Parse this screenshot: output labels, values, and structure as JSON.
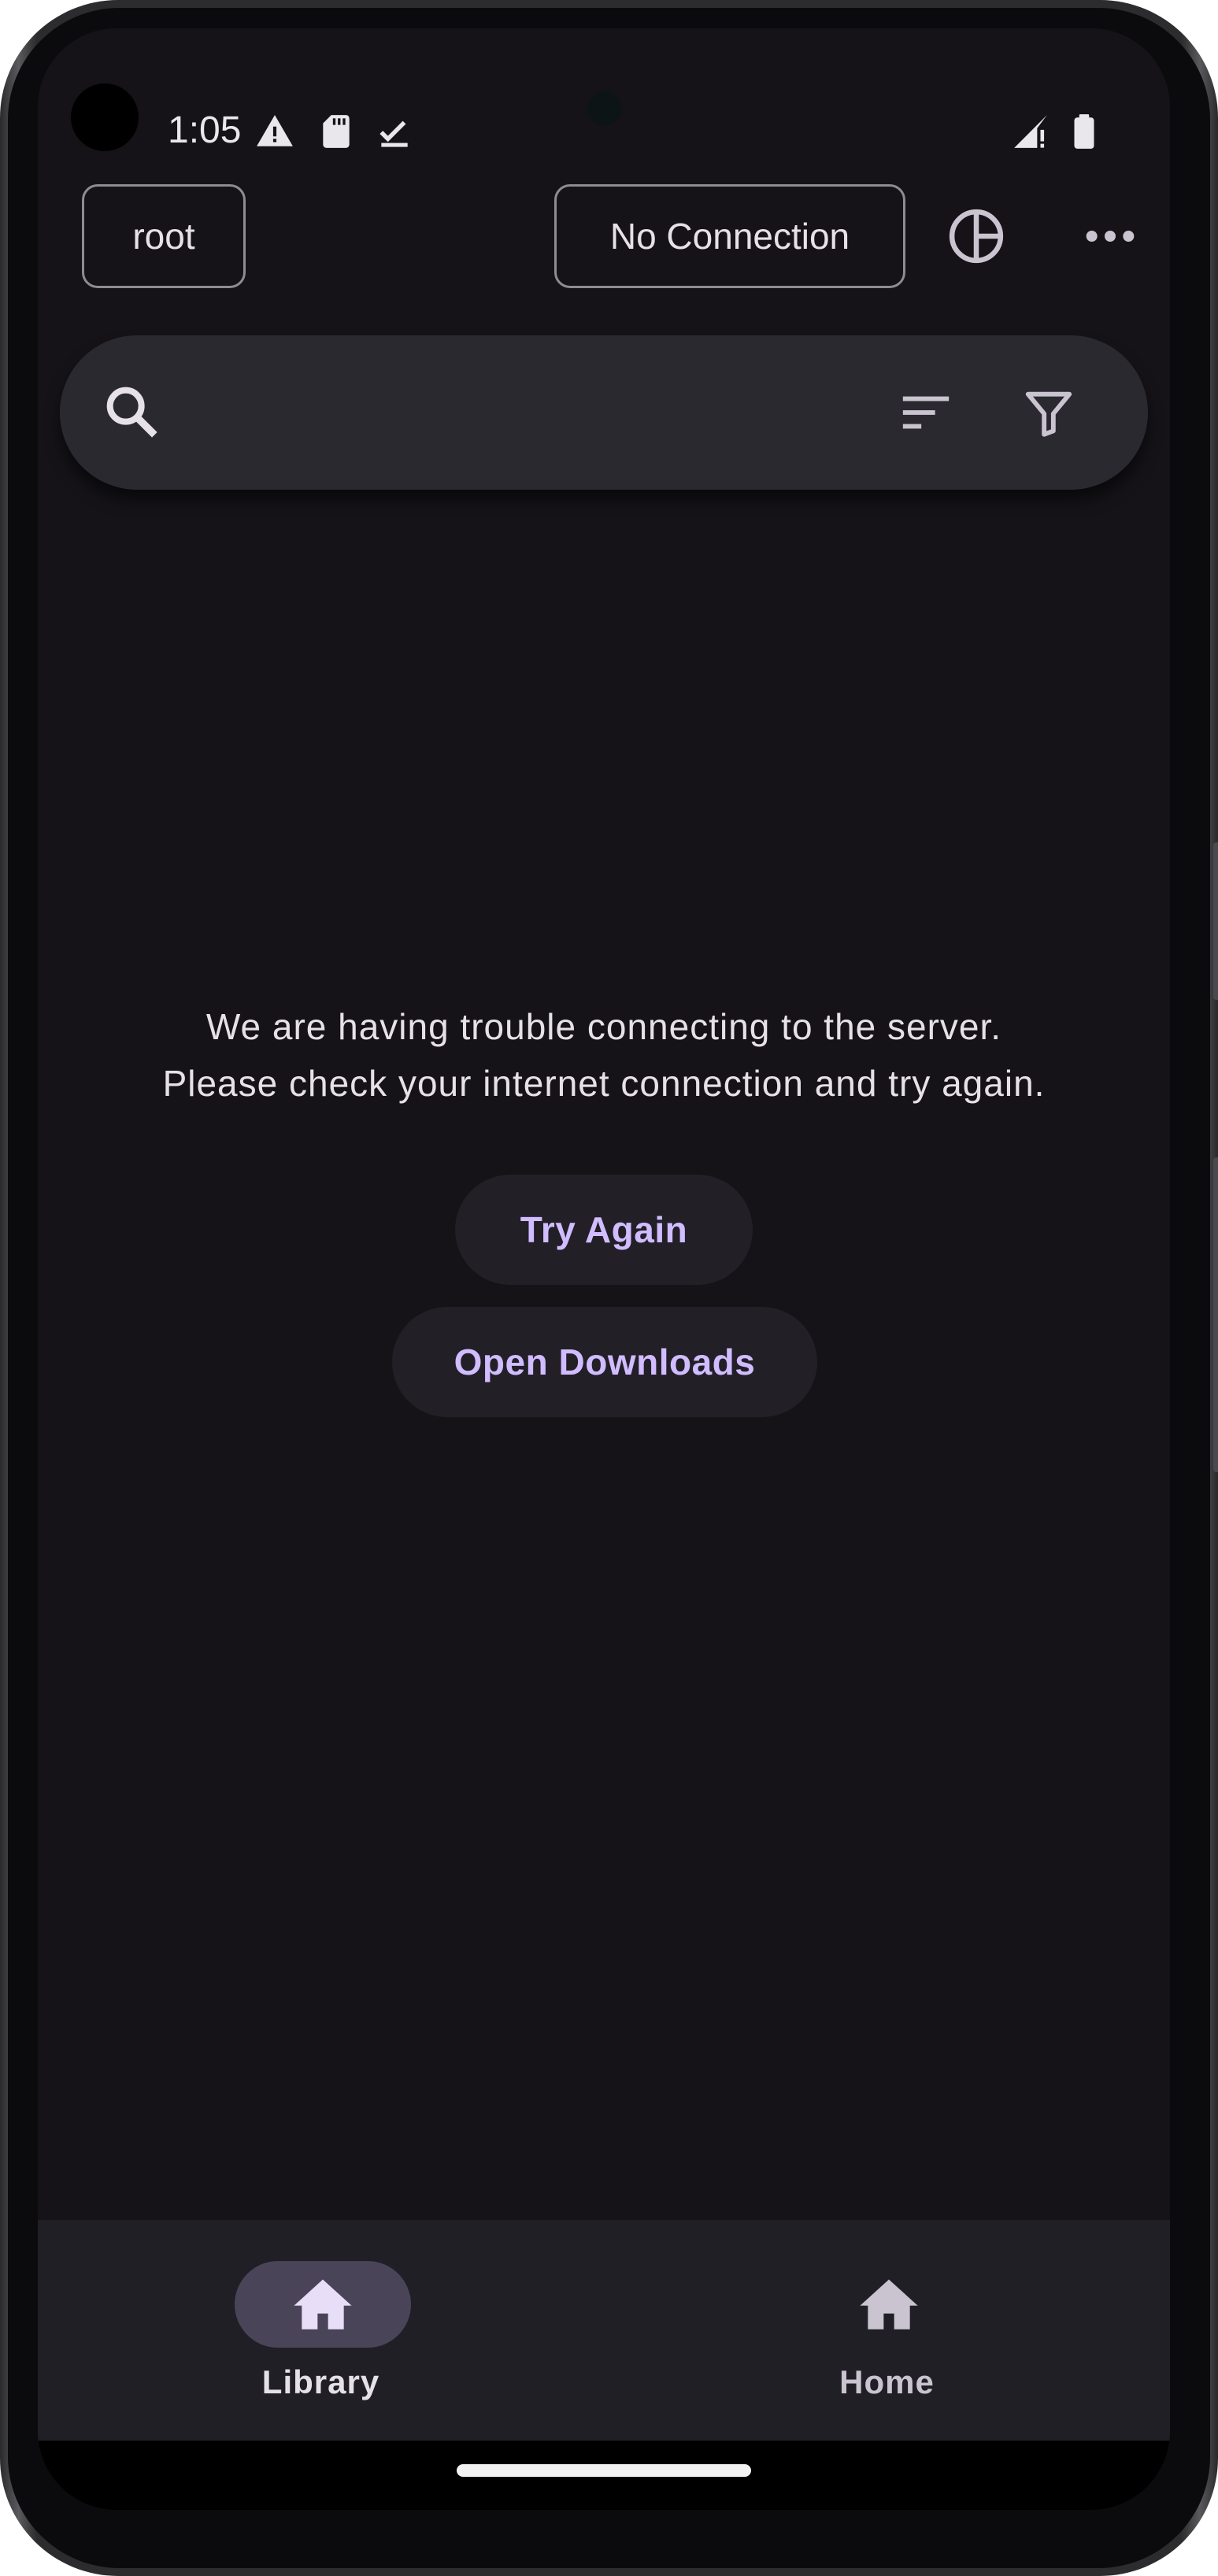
{
  "status_bar": {
    "time": "1:05",
    "left_icons": [
      "warning-icon",
      "sd-card-icon",
      "check-icon"
    ],
    "right_icons": [
      "signal-no-connection-icon",
      "battery-icon"
    ]
  },
  "app_bar": {
    "user_button": "root",
    "connection_button": "No Connection",
    "actions": [
      "pie-chart-icon",
      "more-options-icon"
    ]
  },
  "search": {
    "placeholder": "",
    "icons": [
      "search-icon",
      "sort-icon",
      "filter-icon"
    ]
  },
  "error": {
    "line1": "We are having trouble connecting to the server.",
    "line2": "Please check your internet connection and try again."
  },
  "buttons": {
    "try_again": "Try Again",
    "open_downloads": "Open Downloads"
  },
  "nav": {
    "items": [
      {
        "label": "Library",
        "icon": "home-icon",
        "selected": true
      },
      {
        "label": "Home",
        "icon": "home-icon",
        "selected": false
      }
    ]
  },
  "colors": {
    "background": "#151318",
    "accent": "#d0bcff",
    "surface": "#2b2930",
    "nav_indicator": "#4a4458"
  }
}
